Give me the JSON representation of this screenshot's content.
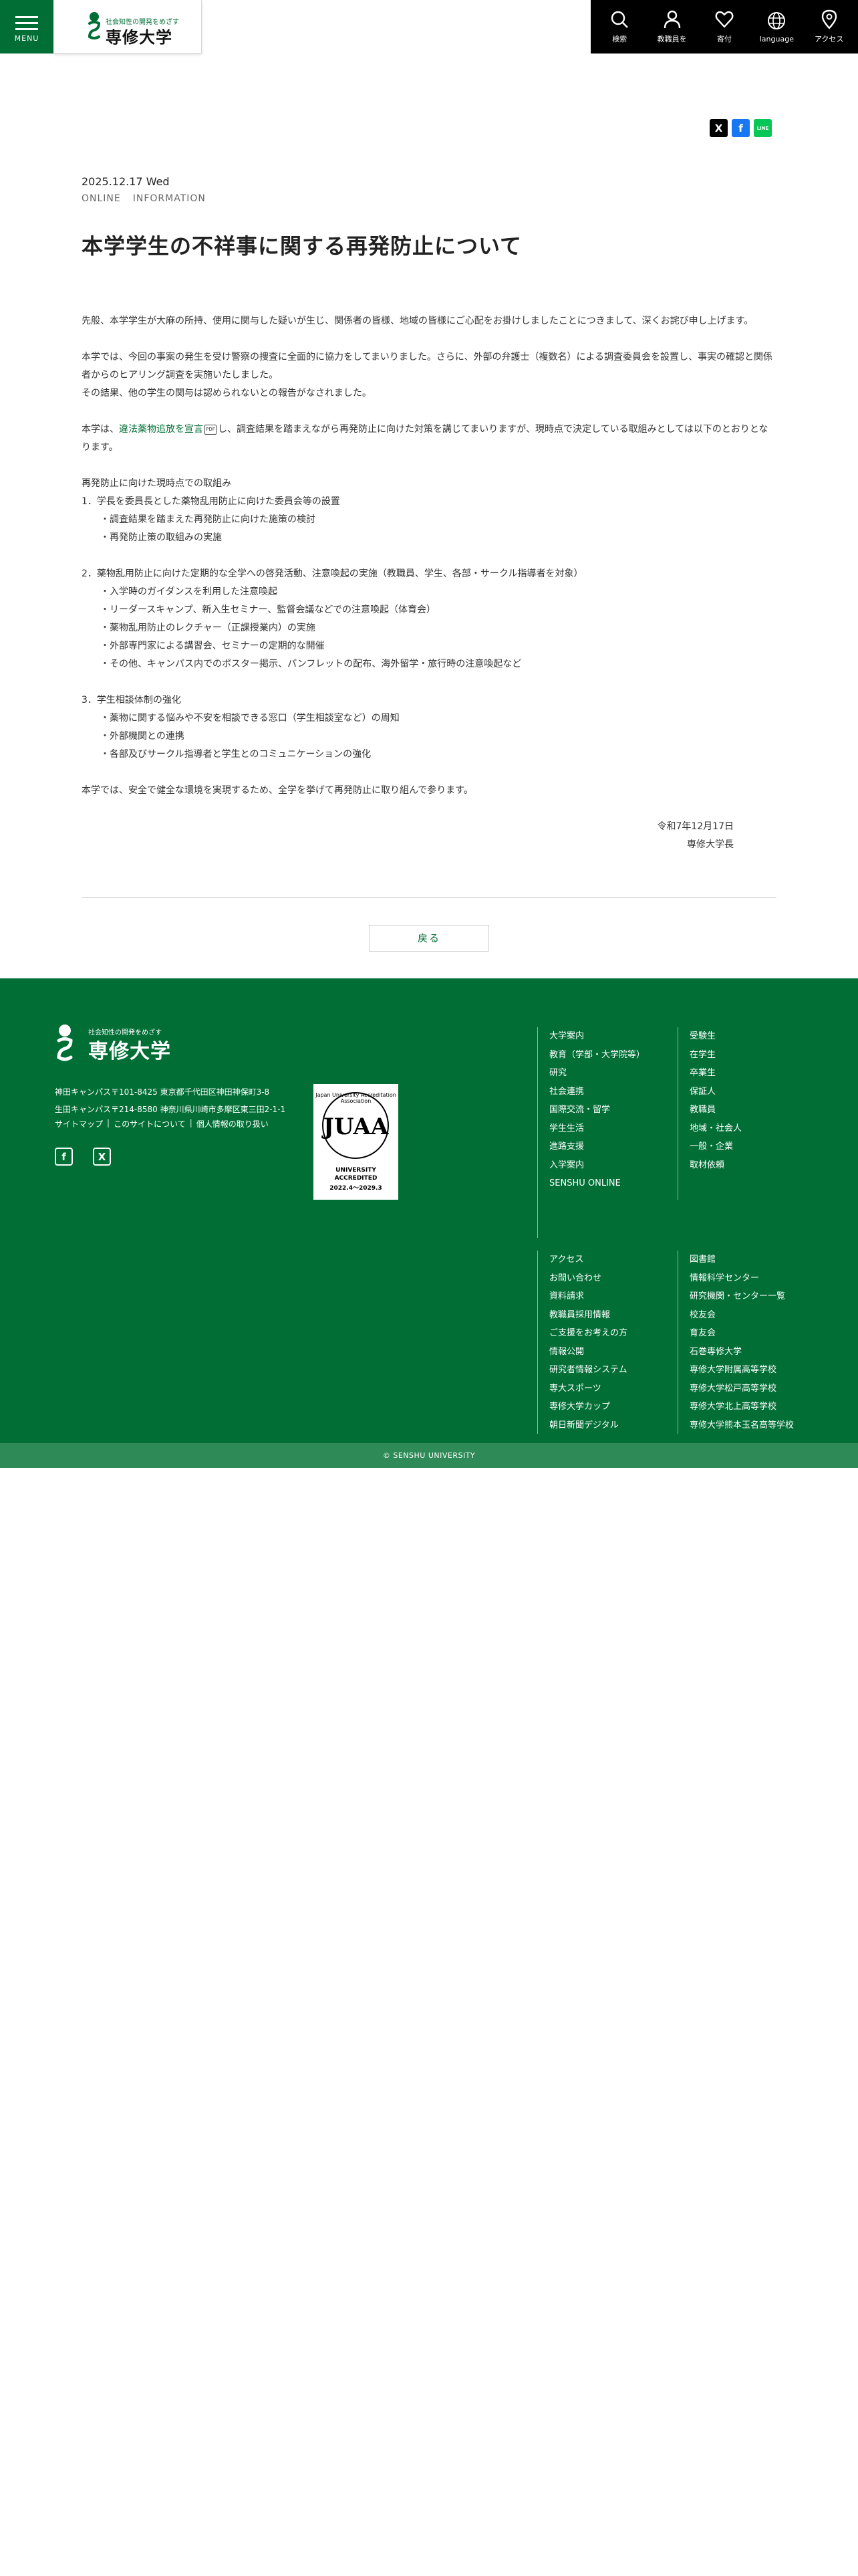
{
  "header": {
    "menu_label": "MENU",
    "logo_tagline": "社会知性の開発をめざす",
    "logo_name": "専修大学",
    "utility": [
      {
        "label": "検索",
        "icon": "search-icon"
      },
      {
        "label": "教職員を",
        "icon": "person-icon"
      },
      {
        "label": "寄付",
        "icon": "heart-icon"
      },
      {
        "label": "language",
        "icon": "globe-icon"
      },
      {
        "label": "アクセス",
        "icon": "map-pin-icon"
      }
    ]
  },
  "share": {
    "x": "X",
    "facebook": "f",
    "line": "LINE"
  },
  "article": {
    "date": "2025.12.17 Wed",
    "categories": [
      "ONLINE",
      "INFORMATION"
    ],
    "title": "本学学生の不祥事に関する再発防止について",
    "para1": "先般、本学学生が大麻の所持、使用に関与した疑いが生じ、関係者の皆様、地域の皆様にご心配をお掛けしましたことにつきまして、深くお詫び申し上げます。",
    "para2a": "本学では、今回の事案の発生を受け警察の捜査に全面的に協力をしてまいりました。さらに、外部の弁護士（複数名）による調査委員会を設置し、事実の確認と関係者からのヒアリング調査を実施いたしました。",
    "para2b": "その結果、他の学生の関与は認められないとの報告がなされました。",
    "para3_pre": "本学は、",
    "para3_link": "違法薬物追放を宣言",
    "para3_pdf": "PDF",
    "para3_post": "し、調査結果を踏まえながら再発防止に向けた対策を講じてまいりますが、現時点で決定している取組みとしては以下のとおりとなります。",
    "list_heading": "再発防止に向けた現時点での取組み",
    "item1": "1．学長を委員長とした薬物乱用防止に向けた委員会等の設置",
    "item1_sub": [
      "・調査結果を踏まえた再発防止に向けた施策の検討",
      "・再発防止策の取組みの実施"
    ],
    "item2": "2．薬物乱用防止に向けた定期的な全学への啓発活動、注意喚起の実施（教職員、学生、各部・サークル指導者を対象）",
    "item2_sub": [
      "・入学時のガイダンスを利用した注意喚起",
      "・リーダースキャンプ、新入生セミナー、監督会議などでの注意喚起（体育会）",
      "・薬物乱用防止のレクチャー（正課授業内）の実施",
      "・外部専門家による講習会、セミナーの定期的な開催",
      "・その他、キャンパス内でのポスター掲示、パンフレットの配布、海外留学・旅行時の注意喚起など"
    ],
    "item3": "3．学生相談体制の強化",
    "item3_sub": [
      "・薬物に関する悩みや不安を相談できる窓口（学生相談室など）の周知",
      "・外部機関との連携",
      "・各部及びサークル指導者と学生とのコミュニケーションの強化"
    ],
    "closing": "本学では、安全で健全な環境を実現するため、全学を挙げて再発防止に取り組んで参ります。",
    "sign_date": "令和7年12月17日",
    "sign_name": "専修大学長"
  },
  "back_label": "戻る",
  "footer": {
    "logo_tagline": "社会知性の開発をめざす",
    "logo_name": "専修大学",
    "address1": "神田キャンパス〒101-8425 東京都千代田区神田神保町3-8",
    "address2": "生田キャンパス〒214-8580 神奈川県川崎市多摩区東三田2-1-1",
    "links": [
      "サイトマップ",
      "このサイトについて",
      "個人情報の取り扱い"
    ],
    "accreditation": {
      "ring_text": "Japan University Accreditation Association",
      "mark": "JUAA",
      "line1": "UNIVERSITY",
      "line2": "ACCREDITED",
      "line3": "2022.4～2029.3"
    },
    "col1": [
      "大学案内",
      "教育（学部・大学院等）",
      "研究",
      "社会連携",
      "国際交流・留学",
      "学生生活",
      "進路支援",
      "入学案内",
      "SENSHU ONLINE"
    ],
    "col2": [
      "受験生",
      "在学生",
      "卒業生",
      "保証人",
      "教職員",
      "地域・社会人",
      "一般・企業",
      "取材依頼"
    ],
    "col3": [
      "アクセス",
      "お問い合わせ",
      "資料請求",
      "教職員採用情報",
      "ご支援をお考えの方",
      "情報公開",
      "研究者情報システム",
      "専大スポーツ",
      "専修大学カップ",
      "朝日新聞デジタル"
    ],
    "col4": [
      "図書館",
      "情報科学センター",
      "研究機関・センター一覧",
      "校友会",
      "育友会",
      "石巻専修大学",
      "専修大学附属高等学校",
      "専修大学松戸高等学校",
      "専修大学北上高等学校",
      "専修大学熊本玉名高等学校"
    ],
    "copyright": "© SENSHU UNIVERSITY"
  },
  "colors": {
    "brand_green": "#006e35",
    "header_black": "#000000",
    "copyright_bar": "#2e8b57",
    "facebook": "#1877f2",
    "line": "#06c755"
  }
}
